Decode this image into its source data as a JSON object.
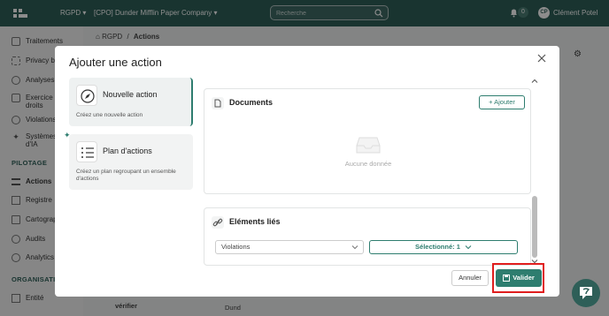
{
  "topbar": {
    "app": "RGPD",
    "company": "[CPO] Dunder Mifflin Paper Company",
    "search_placeholder": "Recherche",
    "notif_count": "0",
    "avatar_initials": "CP",
    "user_name": "Clément Potel"
  },
  "sidebar": {
    "items": [
      {
        "label": "Traitements"
      },
      {
        "label": "Privacy by"
      },
      {
        "label": "Analyses d"
      },
      {
        "label": "Exercice de droits"
      },
      {
        "label": "Violations"
      },
      {
        "label": "Systèmes d'IA"
      }
    ],
    "section_pilotage": "PILOTAGE",
    "pilotage_items": [
      {
        "label": "Actions"
      },
      {
        "label": "Registre"
      },
      {
        "label": "Cartograph"
      },
      {
        "label": "Audits"
      },
      {
        "label": "Analytics"
      }
    ],
    "section_organisation": "ORGANISATIO",
    "org_items": [
      {
        "label": "Entité"
      }
    ]
  },
  "main": {
    "breadcrumb_root": "RGPD",
    "breadcrumb_sep": "/",
    "breadcrumb_current": "Actions",
    "row_text_1": "vérifier",
    "row_text_2": "Dund"
  },
  "modal": {
    "title": "Ajouter une action",
    "options": [
      {
        "title": "Nouvelle action",
        "desc": "Créez une nouvelle action"
      },
      {
        "title": "Plan d'actions",
        "desc": "Créez un plan regroupant un ensemble d'actions"
      }
    ],
    "documents": {
      "title": "Documents",
      "add_label": "Ajouter",
      "empty_text": "Aucune donnée"
    },
    "linked": {
      "title": "Eléments liés",
      "select_value": "Violations",
      "selected_label": "Sélectionné: 1"
    },
    "cancel_label": "Annuler",
    "validate_label": "Valider"
  },
  "colors": {
    "brand": "#2e5f58",
    "accent": "#2e7d6f",
    "highlight": "#e01e1e"
  }
}
